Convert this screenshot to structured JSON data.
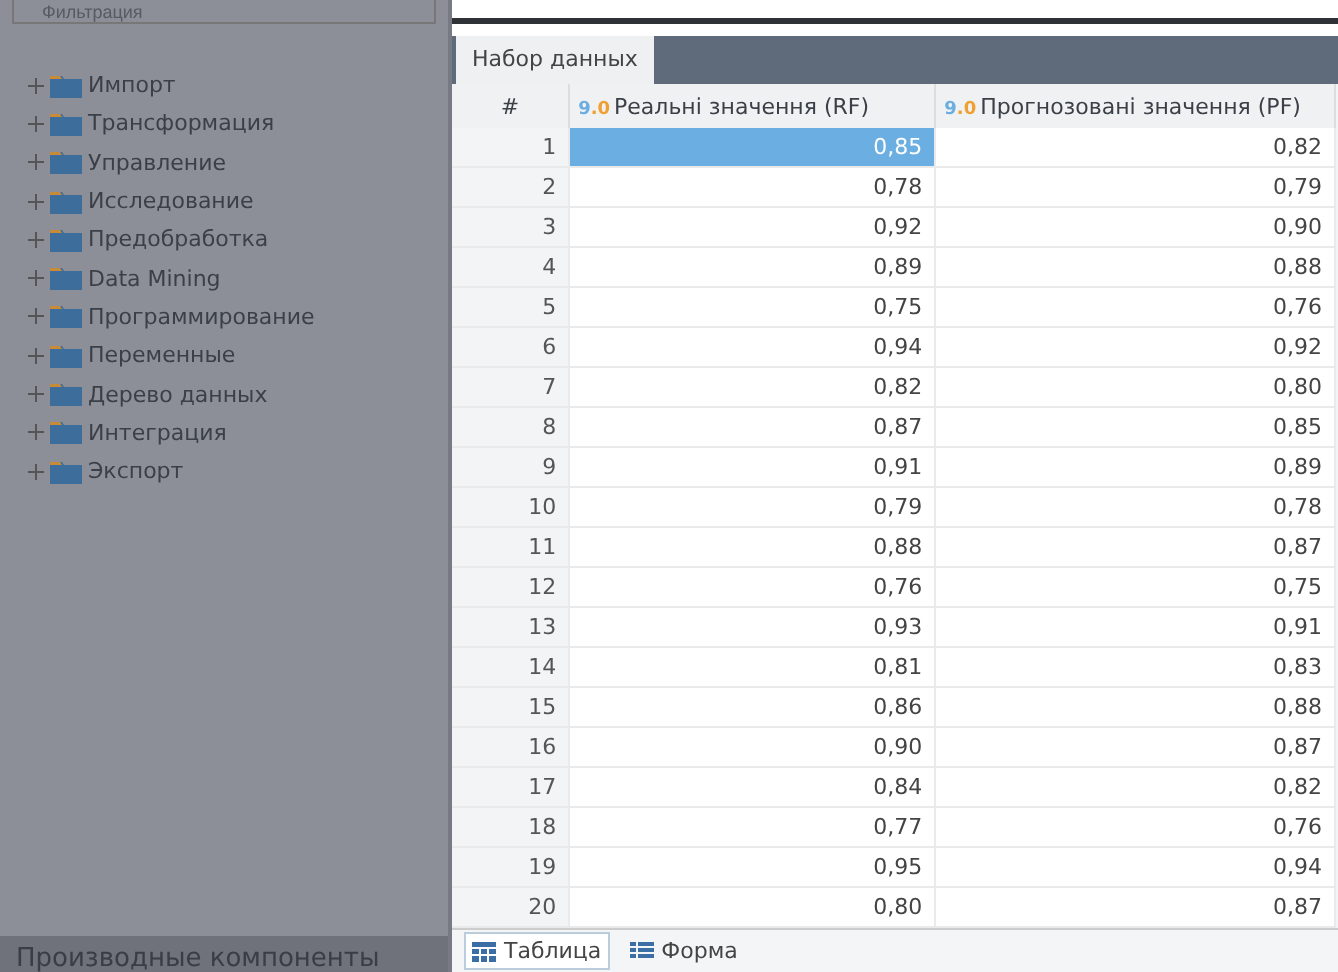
{
  "sidebar": {
    "filter": {
      "placeholder": "Фильтрация"
    },
    "tree": [
      {
        "label": "Импорт",
        "expanded": false
      },
      {
        "label": "Трансформация",
        "expanded": false
      },
      {
        "label": "Управление",
        "expanded": false
      },
      {
        "label": "Исследование",
        "expanded": false
      },
      {
        "label": "Предобработка",
        "expanded": false
      },
      {
        "label": "Data Mining",
        "expanded": false
      },
      {
        "label": "Программирование",
        "expanded": false
      },
      {
        "label": "Переменные",
        "expanded": false
      },
      {
        "label": "Дерево данных",
        "expanded": false
      },
      {
        "label": "Интеграция",
        "expanded": false
      },
      {
        "label": "Экспорт",
        "expanded": false
      }
    ],
    "footer": "Производные компоненты"
  },
  "panel": {
    "tabs": [
      {
        "label": "Набор данных",
        "selected": true
      }
    ],
    "table": {
      "columns": [
        {
          "label": "#",
          "kind": "index"
        },
        {
          "label": "Реальні значення (RF)",
          "kind": "number",
          "type_icon": [
            "9",
            ".0"
          ]
        },
        {
          "label": "Прогнозовані значення (PF)",
          "kind": "number",
          "type_icon": [
            "9",
            ".0"
          ]
        }
      ],
      "selected_first_cell": true,
      "rows": [
        [
          "1",
          "0,85",
          "0,82"
        ],
        [
          "2",
          "0,78",
          "0,79"
        ],
        [
          "3",
          "0,92",
          "0,90"
        ],
        [
          "4",
          "0,89",
          "0,88"
        ],
        [
          "5",
          "0,75",
          "0,76"
        ],
        [
          "6",
          "0,94",
          "0,92"
        ],
        [
          "7",
          "0,82",
          "0,80"
        ],
        [
          "8",
          "0,87",
          "0,85"
        ],
        [
          "9",
          "0,91",
          "0,89"
        ],
        [
          "10",
          "0,79",
          "0,78"
        ],
        [
          "11",
          "0,88",
          "0,87"
        ],
        [
          "12",
          "0,76",
          "0,75"
        ],
        [
          "13",
          "0,93",
          "0,91"
        ],
        [
          "14",
          "0,81",
          "0,83"
        ],
        [
          "15",
          "0,86",
          "0,88"
        ],
        [
          "16",
          "0,90",
          "0,87"
        ],
        [
          "17",
          "0,84",
          "0,82"
        ],
        [
          "18",
          "0,77",
          "0,76"
        ],
        [
          "19",
          "0,95",
          "0,94"
        ],
        [
          "20",
          "0,80",
          "0,87"
        ]
      ]
    },
    "view_tabs": [
      {
        "label": "Таблица",
        "selected": true,
        "kind": "table"
      },
      {
        "label": "Форма",
        "selected": false,
        "kind": "form"
      }
    ]
  }
}
